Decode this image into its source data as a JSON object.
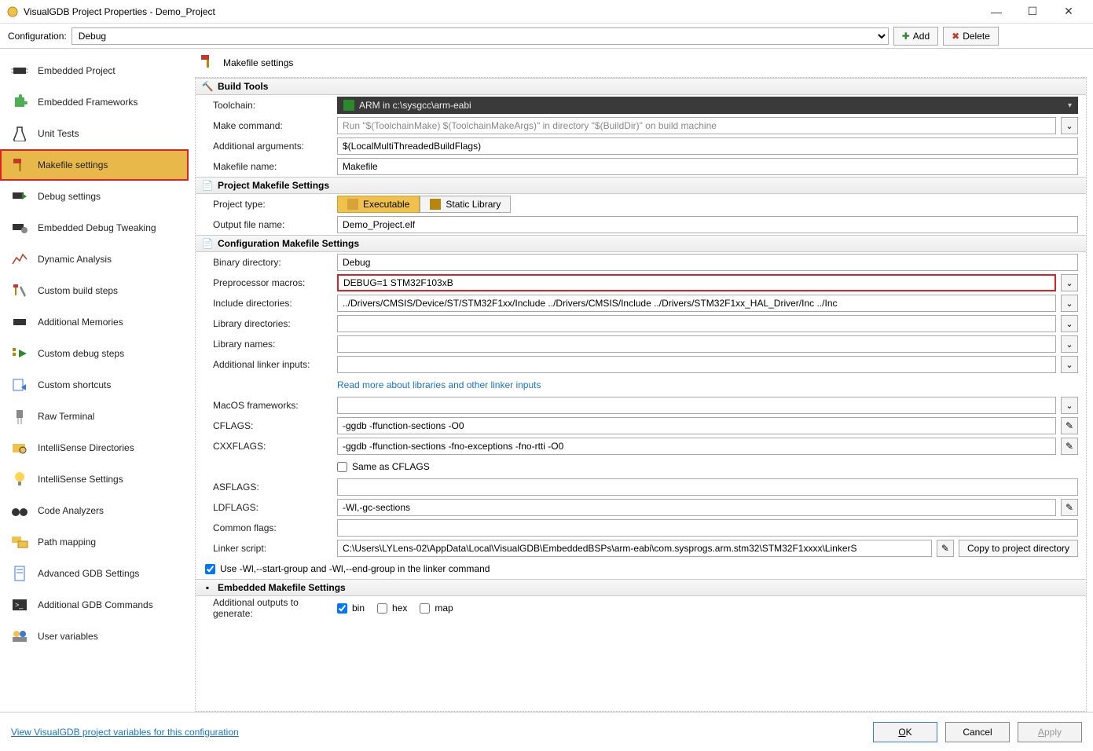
{
  "window": {
    "title": "VisualGDB Project Properties - Demo_Project"
  },
  "toolbar": {
    "config_label": "Configuration:",
    "config_value": "Debug",
    "add": "Add",
    "delete": "Delete"
  },
  "sidebar": {
    "items": [
      {
        "label": "Embedded Project"
      },
      {
        "label": "Embedded Frameworks"
      },
      {
        "label": "Unit Tests"
      },
      {
        "label": "Makefile settings"
      },
      {
        "label": "Debug settings"
      },
      {
        "label": "Embedded Debug Tweaking"
      },
      {
        "label": "Dynamic Analysis"
      },
      {
        "label": "Custom build steps"
      },
      {
        "label": "Additional Memories"
      },
      {
        "label": "Custom debug steps"
      },
      {
        "label": "Custom shortcuts"
      },
      {
        "label": "Raw Terminal"
      },
      {
        "label": "IntelliSense Directories"
      },
      {
        "label": "IntelliSense Settings"
      },
      {
        "label": "Code Analyzers"
      },
      {
        "label": "Path mapping"
      },
      {
        "label": "Advanced GDB Settings"
      },
      {
        "label": "Additional GDB Commands"
      },
      {
        "label": "User variables"
      }
    ]
  },
  "header": {
    "title": "Makefile settings"
  },
  "sections": {
    "build_tools": {
      "head": "Build Tools",
      "toolchain_label": "Toolchain:",
      "toolchain_value": "ARM in c:\\sysgcc\\arm-eabi",
      "make_cmd_label": "Make command:",
      "make_cmd_value": "Run \"$(ToolchainMake) $(ToolchainMakeArgs)\" in directory \"$(BuildDir)\" on build machine",
      "addl_args_label": "Additional arguments:",
      "addl_args_value": "$(LocalMultiThreadedBuildFlags)",
      "makefile_name_label": "Makefile name:",
      "makefile_name_value": "Makefile"
    },
    "project_make": {
      "head": "Project Makefile Settings",
      "project_type_label": "Project type:",
      "exe": "Executable",
      "static": "Static Library",
      "output_label": "Output file name:",
      "output_value": "Demo_Project.elf"
    },
    "config_make": {
      "head": "Configuration Makefile Settings",
      "bin_dir_label": "Binary directory:",
      "bin_dir_value": "Debug",
      "pp_macros_label": "Preprocessor macros:",
      "pp_macros_value": "DEBUG=1 STM32F103xB",
      "inc_dirs_label": "Include directories:",
      "inc_dirs_value": "../Drivers/CMSIS/Device/ST/STM32F1xx/Include ../Drivers/CMSIS/Include ../Drivers/STM32F1xx_HAL_Driver/Inc ../Inc",
      "lib_dirs_label": "Library directories:",
      "lib_names_label": "Library names:",
      "addl_linker_label": "Additional linker inputs:",
      "linker_link": "Read more about libraries and other linker inputs",
      "macos_label": "MacOS frameworks:",
      "cflags_label": "CFLAGS:",
      "cflags_value": "-ggdb -ffunction-sections -O0",
      "cxxflags_label": "CXXFLAGS:",
      "cxxflags_value": "-ggdb -ffunction-sections -fno-exceptions -fno-rtti -O0",
      "same_as_cflags": "Same as CFLAGS",
      "asflags_label": "ASFLAGS:",
      "ldflags_label": "LDFLAGS:",
      "ldflags_value": "-Wl,-gc-sections",
      "common_label": "Common flags:",
      "linker_script_label": "Linker script:",
      "linker_script_value": "C:\\Users\\LYLens-02\\AppData\\Local\\VisualGDB\\EmbeddedBSPs\\arm-eabi\\com.sysprogs.arm.stm32\\STM32F1xxxx\\LinkerS",
      "copy_btn": "Copy to project directory",
      "use_wl": "Use -Wl,--start-group and -Wl,--end-group in the linker command"
    },
    "embedded_make": {
      "head": "Embedded Makefile Settings",
      "outputs_label": "Additional outputs to generate:",
      "bin": "bin",
      "hex": "hex",
      "map": "map"
    }
  },
  "footer": {
    "link": "View VisualGDB project variables for this configuration",
    "ok": "OK",
    "cancel": "Cancel",
    "apply": "Apply"
  }
}
